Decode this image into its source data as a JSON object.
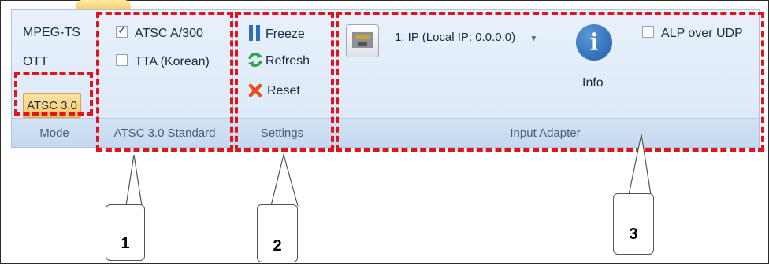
{
  "mode": {
    "items": [
      "MPEG-TS",
      "OTT",
      "ATSC 3.0"
    ],
    "footer": "Mode"
  },
  "standard": {
    "atsc_a300": "ATSC A/300",
    "tta_korean": "TTA (Korean)",
    "footer": "ATSC 3.0 Standard",
    "atsc_a300_checked": true,
    "tta_checked": false
  },
  "settings": {
    "freeze": "Freeze",
    "refresh": "Refresh",
    "reset": "Reset",
    "footer": "Settings"
  },
  "input_adapter": {
    "selected": "1: IP (Local IP: 0.0.0.0)",
    "info": "Info",
    "alp_over_udp": "ALP over UDP",
    "footer": "Input Adapter"
  },
  "callouts": [
    "1",
    "2",
    "3"
  ],
  "colors": {
    "highlight_red": "#e4121a",
    "ribbon_bg": "#e8f1fb",
    "info_blue": "#2f6fb8"
  }
}
